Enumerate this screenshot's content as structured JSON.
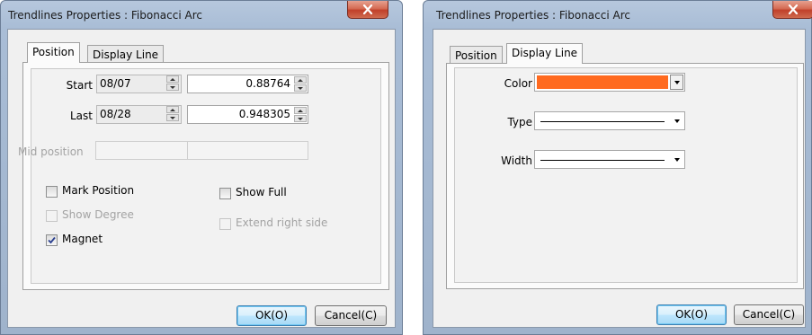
{
  "dialog_left": {
    "title": "Trendlines Properties : Fibonacci Arc",
    "tabs": [
      {
        "label": "Position",
        "active": true
      },
      {
        "label": "Display Line",
        "active": false
      }
    ],
    "start": {
      "label": "Start",
      "date": "08/07",
      "value": "0.88764"
    },
    "last": {
      "label": "Last",
      "date": "08/28",
      "value": "0.948305"
    },
    "mid": {
      "label": "Mid position",
      "date": "",
      "value": ""
    },
    "checkboxes": {
      "mark_position": {
        "label": "Mark Position",
        "checked": false,
        "enabled": true
      },
      "show_full": {
        "label": "Show Full",
        "checked": false,
        "enabled": true
      },
      "show_degree": {
        "label": "Show Degree",
        "checked": false,
        "enabled": false
      },
      "extend_right": {
        "label": "Extend right side",
        "checked": false,
        "enabled": false
      },
      "magnet": {
        "label": "Magnet",
        "checked": true,
        "enabled": true
      }
    },
    "ok_label": "OK(O)",
    "cancel_label": "Cancel(C)"
  },
  "dialog_right": {
    "title": "Trendlines Properties : Fibonacci Arc",
    "tabs": [
      {
        "label": "Position",
        "active": false
      },
      {
        "label": "Display Line",
        "active": true
      }
    ],
    "color_label": "Color",
    "color_value": "#ff6a1f",
    "type_label": "Type",
    "width_label": "Width",
    "ok_label": "OK(O)",
    "cancel_label": "Cancel(C)"
  },
  "icons": {
    "close": "close-icon",
    "spin_up": "spin-up-icon",
    "spin_down": "spin-down-icon",
    "dropdown": "chevron-down-icon",
    "check": "checkmark-icon"
  },
  "colors": {
    "titlebar": "#a9bdd6",
    "close_button": "#c8503a",
    "client_bg": "#f0f0f0",
    "default_button": "#bee6fd"
  }
}
